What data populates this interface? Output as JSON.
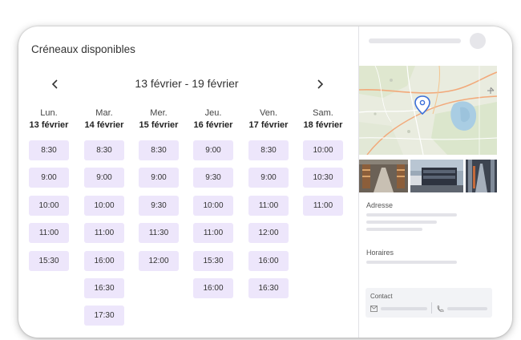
{
  "calendar": {
    "title": "Créneaux disponibles",
    "week_range": "13 février - 19 février",
    "prev_label": "‹",
    "next_label": "›",
    "days": [
      {
        "day": "Lun.",
        "date": "13 février",
        "slots": [
          "8:30",
          "9:00",
          "10:00",
          "11:00",
          "15:30"
        ]
      },
      {
        "day": "Mar.",
        "date": "14 février",
        "slots": [
          "8:30",
          "9:00",
          "10:00",
          "11:00",
          "16:00",
          "16:30",
          "17:30"
        ]
      },
      {
        "day": "Mer.",
        "date": "15 février",
        "slots": [
          "8:30",
          "9:00",
          "9:30",
          "11:30",
          "12:00"
        ]
      },
      {
        "day": "Jeu.",
        "date": "16 février",
        "slots": [
          "9:00",
          "9:30",
          "10:00",
          "11:00",
          "15:30",
          "16:00"
        ]
      },
      {
        "day": "Ven.",
        "date": "17 février",
        "slots": [
          "8:30",
          "9:00",
          "11:00",
          "12:00",
          "16:00",
          "16:30"
        ]
      },
      {
        "day": "Sam.",
        "date": "18 février",
        "slots": [
          "10:00",
          "10:30",
          "11:00"
        ]
      }
    ]
  },
  "sidebar": {
    "address_label": "Adresse",
    "hours_label": "Horaires",
    "contact_label": "Contact"
  },
  "colors": {
    "slot_bg": "#ede6fb",
    "map_pin": "#3b6fd8"
  }
}
